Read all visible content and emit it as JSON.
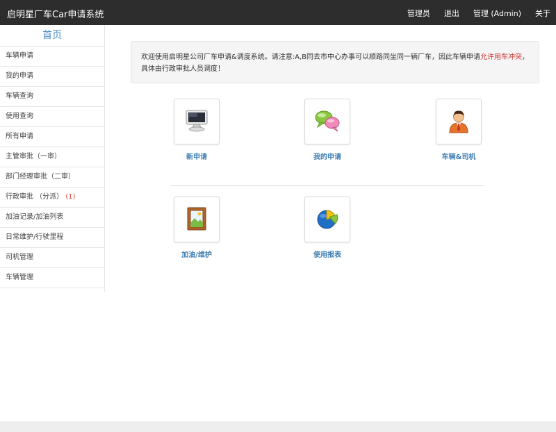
{
  "header": {
    "title": "启明星厂车Car申请系统",
    "nav": [
      "管理员",
      "退出",
      "管理 (Admin)",
      "关于"
    ]
  },
  "sidebar": {
    "home": "首页",
    "items": [
      {
        "label": "车辆申请"
      },
      {
        "label": "我的申请"
      },
      {
        "label": "车辆查询"
      },
      {
        "label": "使用查询"
      },
      {
        "label": "所有申请"
      },
      {
        "label": "主管审批（一审）"
      },
      {
        "label": "部门经理审批（二审）"
      },
      {
        "label": "行政审批 （分派）",
        "count": "(1)"
      },
      {
        "label": "加油记录/加油列表"
      },
      {
        "label": "日常维护/行驶里程"
      },
      {
        "label": "司机管理"
      },
      {
        "label": "车辆管理"
      }
    ]
  },
  "notice": {
    "text_before": "欢迎使用启明星公司厂车申请&调度系统。请注意:A,B同去市中心办事可以顺路同坐同一辆厂车，因此车辆申请",
    "highlight": "允许用车冲突",
    "text_after": "，具体由行政审批人员调度！"
  },
  "tiles": [
    {
      "label": "新申请",
      "icon": "computer-icon"
    },
    {
      "label": "我的申请",
      "icon": "chat-bubbles-icon"
    },
    {
      "label": "车辆&司机",
      "icon": "person-icon"
    },
    {
      "label": "加油/维护",
      "icon": "picture-frame-icon"
    },
    {
      "label": "使用报表",
      "icon": "pie-chart-icon"
    }
  ],
  "colors": {
    "topbar": "#2d2d2d",
    "accent": "#3f7fb5",
    "highlight": "#c9302c"
  }
}
